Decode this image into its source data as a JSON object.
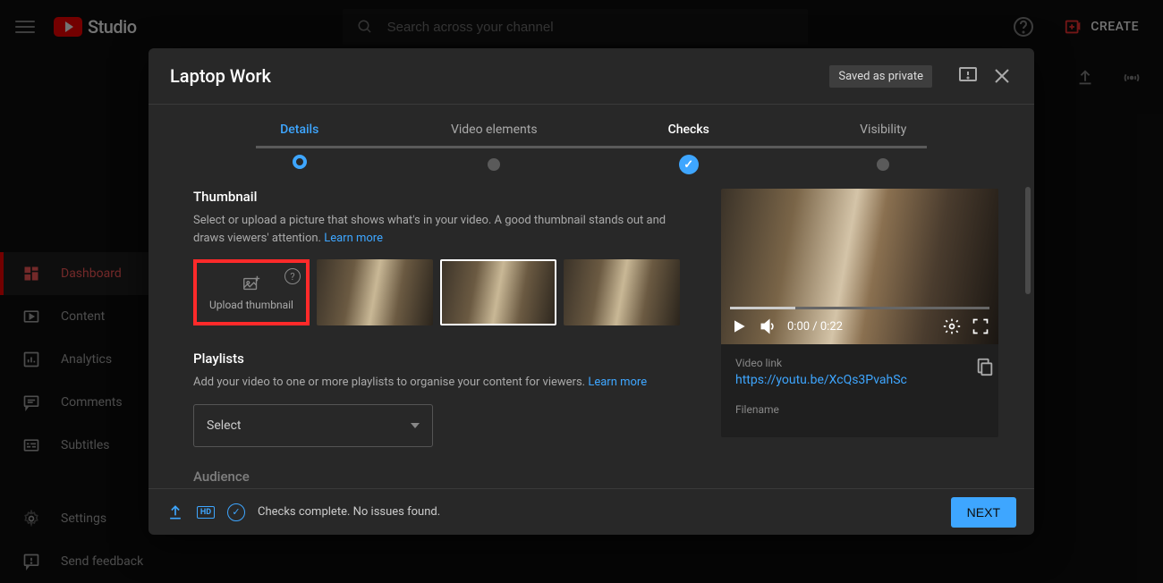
{
  "app": {
    "name": "Studio"
  },
  "search": {
    "placeholder": "Search across your channel"
  },
  "topbar": {
    "create": "CREATE"
  },
  "sidebar": {
    "items": [
      {
        "label": "Dashboard"
      },
      {
        "label": "Content"
      },
      {
        "label": "Analytics"
      },
      {
        "label": "Comments"
      },
      {
        "label": "Subtitles"
      }
    ],
    "bottom": [
      {
        "label": "Settings"
      },
      {
        "label": "Send feedback"
      }
    ]
  },
  "modal": {
    "title": "Laptop Work",
    "saved_badge": "Saved as private",
    "steps": {
      "details": "Details",
      "video_elements": "Video elements",
      "checks": "Checks",
      "visibility": "Visibility"
    },
    "thumbnail": {
      "title": "Thumbnail",
      "desc_a": "Select or upload a picture that shows what's in your video. A good thumbnail stands out and draws viewers' attention. ",
      "learn_more": "Learn more",
      "upload_label": "Upload thumbnail"
    },
    "playlists": {
      "title": "Playlists",
      "desc_a": "Add your video to one or more playlists to organise your content for viewers. ",
      "learn_more": "Learn more",
      "select": "Select"
    },
    "audience": {
      "title": "Audience"
    },
    "preview": {
      "time": "0:00 / 0:22",
      "link_label": "Video link",
      "link": "https://youtu.be/XcQs3PvahSc",
      "filename_label": "Filename"
    },
    "footer": {
      "hd": "HD",
      "status": "Checks complete. No issues found.",
      "next": "NEXT"
    }
  }
}
